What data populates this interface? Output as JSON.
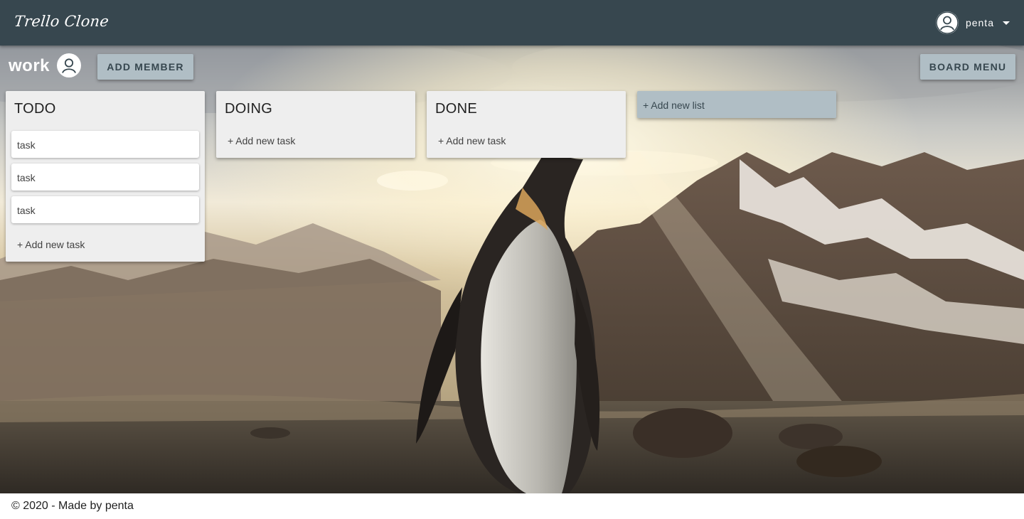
{
  "header": {
    "brand": "Trello Clone",
    "user": {
      "name": "penta",
      "avatar_icon": "account-circle-icon",
      "menu_icon": "caret-down-icon"
    }
  },
  "board": {
    "title": "work",
    "member_icon": "account-circle-icon",
    "add_member_label": "ADD MEMBER",
    "board_menu_label": "BOARD MENU",
    "lists": [
      {
        "title": "TODO",
        "cards": [
          "task",
          "task",
          "task"
        ],
        "add_task_label": "+ Add new task"
      },
      {
        "title": "DOING",
        "cards": [],
        "add_task_label": "+ Add new task"
      },
      {
        "title": "DONE",
        "cards": [],
        "add_task_label": "+ Add new task"
      }
    ],
    "add_list_label": "+ Add new list"
  },
  "footer": {
    "text": "© 2020 - Made by penta"
  },
  "colors": {
    "appbar": "#37474f",
    "button": "#b0bec5",
    "list_bg": "#eeeeee",
    "card_bg": "#ffffff"
  }
}
